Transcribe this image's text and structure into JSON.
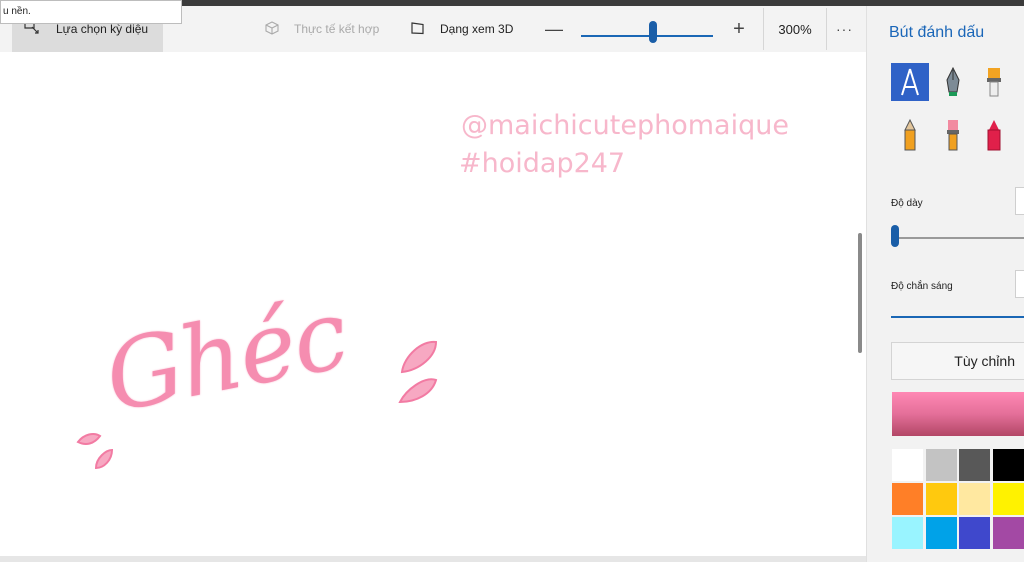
{
  "tooltip": {
    "text": "u nền."
  },
  "toolbar": {
    "magic_select": "Lựa chọn kỳ diệu",
    "mixed_reality": "Thực tế kết hợp",
    "view_3d": "Dạng xem 3D",
    "zoom_minus": "—",
    "zoom_plus": "+",
    "zoom_level": "300%",
    "more": "···",
    "zoom_slider_position": 0.52
  },
  "canvas": {
    "handle": "@maichicutephomaique",
    "hashtag": "#hoidap247",
    "lettering": "Ghéc"
  },
  "panel": {
    "title": "Bút đánh dấu",
    "thickness_label": "Độ dày",
    "opacity_label": "Độ chắn sáng",
    "customize_button": "Tùy chỉnh",
    "brushes": [
      "calligraphy-pen",
      "ink-pen",
      "oil-brush",
      "pencil",
      "watercolor",
      "crayon"
    ],
    "selected_brush": "calligraphy-pen",
    "current_color": "#ec7aa3",
    "palette": [
      "#ffffff",
      "#c3c3c3",
      "#585858",
      "#000000",
      "#ff7f27",
      "#ffc90e",
      "#ffe8a0",
      "#fff200",
      "#99f4ff",
      "#00a2e8",
      "#3f48cc",
      "#a349a4"
    ]
  },
  "colors": {
    "accent": "#1a66b8",
    "lettering_pink": "#f58db0",
    "text_pink": "#f7b7cb"
  }
}
